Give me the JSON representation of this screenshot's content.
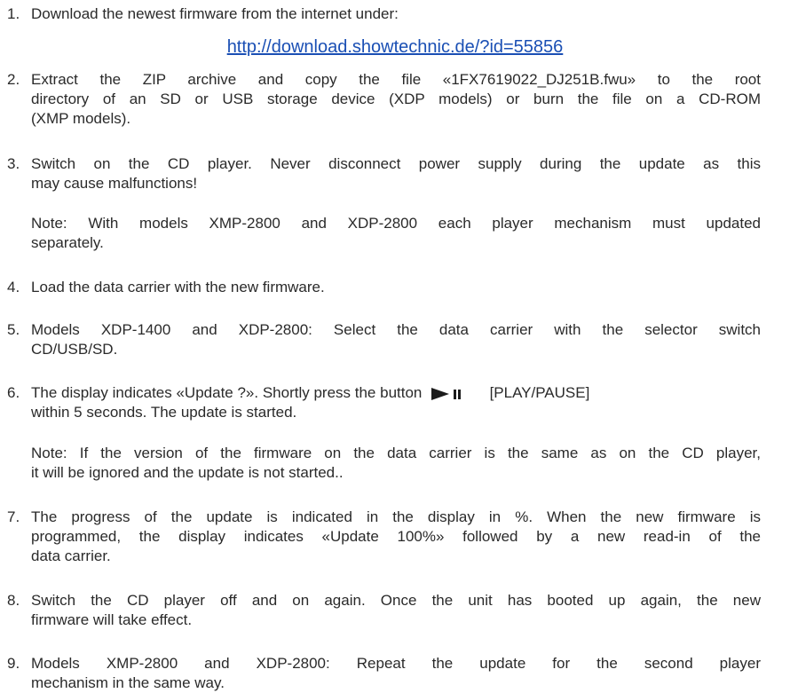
{
  "steps": [
    {
      "number": "1.",
      "text": "Download the newest firmware from the internet under:",
      "link": "http://download.showtechnic.de/?id=55856"
    },
    {
      "number": "2.",
      "lines": [
        "Extract the ZIP archive and copy the file «1FX7619022_DJ251B.fwu» to the root",
        "directory of an SD or USB storage device (XDP models) or burn the file on a CD-ROM",
        "(XMP models)."
      ]
    },
    {
      "number": "3.",
      "lines": [
        "Switch on the CD player. Never disconnect power supply during the update as this",
        "may cause malfunctions!"
      ],
      "note_lines": [
        "Note: With models XMP-2800 and XDP-2800 each player mechanism must updated",
        "separately."
      ]
    },
    {
      "number": "4.",
      "lines": [
        "Load the data carrier with the new firmware."
      ]
    },
    {
      "number": "5.",
      "lines": [
        "Models XDP-1400 and XDP-2800: Select the data carrier with the selector switch",
        "CD/USB/SD."
      ]
    },
    {
      "number": "6.",
      "line1_before": "The display indicates «Update ?». Shortly press the  button",
      "line1_after": "[PLAY/PAUSE]",
      "line2": "within 5 seconds. The update is started.",
      "note_lines": [
        "Note: If the version of the firmware on the data carrier is the same as on the CD player,",
        "it will be ignored and the update is not started.."
      ]
    },
    {
      "number": "7.",
      "lines": [
        "The progress of the update is indicated in the display in %. When the new firmware is",
        "programmed, the display indicates «Update 100%» followed by a new read-in of the",
        "data carrier."
      ]
    },
    {
      "number": "8.",
      "lines": [
        "Switch the CD player off and on again. Once the unit has booted up again, the new",
        "firmware will take effect."
      ]
    },
    {
      "number": "9.",
      "lines": [
        "Models XMP-2800 and XDP-2800: Repeat the update for the second player",
        "mechanism in the same way."
      ]
    }
  ],
  "icons": {
    "play_pause": "play-pause-icon"
  },
  "colors": {
    "text": "#2a2a2a",
    "link": "#1a4fb4"
  }
}
